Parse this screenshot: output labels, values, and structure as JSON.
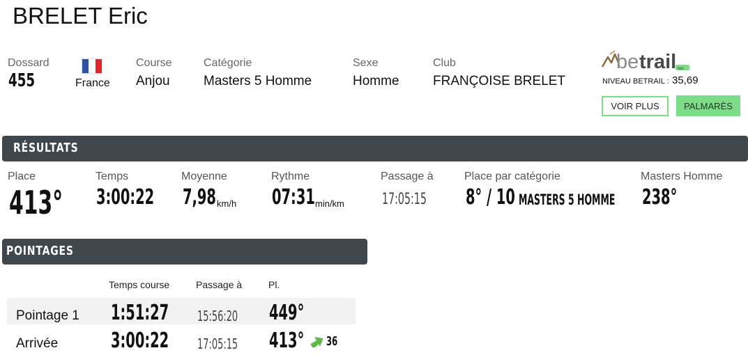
{
  "runner": {
    "name": "BRELET Eric"
  },
  "info": {
    "dossard_label": "Dossard",
    "dossard_value": "455",
    "country": "France",
    "course_label": "Course",
    "course_value": "Anjou",
    "categorie_label": "Catégorie",
    "categorie_value": "Masters 5 Homme",
    "sexe_label": "Sexe",
    "sexe_value": "Homme",
    "club_label": "Club",
    "club_value": "FRANÇOISE BRELET"
  },
  "betrail": {
    "logo_text_be": "be",
    "logo_text_trail": "trail",
    "logo_badge": "run",
    "niveau_label": "NIVEAU BETRAIL :",
    "niveau_value": "35,69",
    "voir_plus": "VOIR PLUS",
    "palmares": "PALMARÈS"
  },
  "colors": {
    "dark_bar": "#3f464c",
    "green": "#7ddc87",
    "flag_blue": "#2f4fa8",
    "flag_red": "#e0262b",
    "logo_gray": "#8a8a8a",
    "logo_dark": "#4a4a4a"
  },
  "resultats": {
    "title": "RÉSULTATS",
    "place_label": "Place",
    "place_value": "413°",
    "temps_label": "Temps",
    "temps_value": "3:00:22",
    "moyenne_label": "Moyenne",
    "moyenne_value": "7,98",
    "moyenne_unit": "km/h",
    "rythme_label": "Rythme",
    "rythme_value": "07:31",
    "rythme_unit": "min/km",
    "passage_label": "Passage à",
    "passage_value": "17:05:15",
    "placecat_label": "Place par catégorie",
    "placecat_value": "8° / 10",
    "placecat_cat": "MASTERS 5 HOMME",
    "masters_label": "Masters Homme",
    "masters_value": "238°"
  },
  "pointages": {
    "title": "POINTAGES",
    "headers": {
      "temps": "Temps course",
      "passage": "Passage à",
      "place": "Pl."
    },
    "rows": [
      {
        "name": "Pointage 1",
        "temps": "1:51:27",
        "passage": "15:56:20",
        "place": "449°",
        "gain": ""
      },
      {
        "name": "Arrivée",
        "temps": "3:00:22",
        "passage": "17:05:15",
        "place": "413°",
        "gain": "36",
        "gain_icon": "green-up-arrow-icon"
      }
    ]
  }
}
